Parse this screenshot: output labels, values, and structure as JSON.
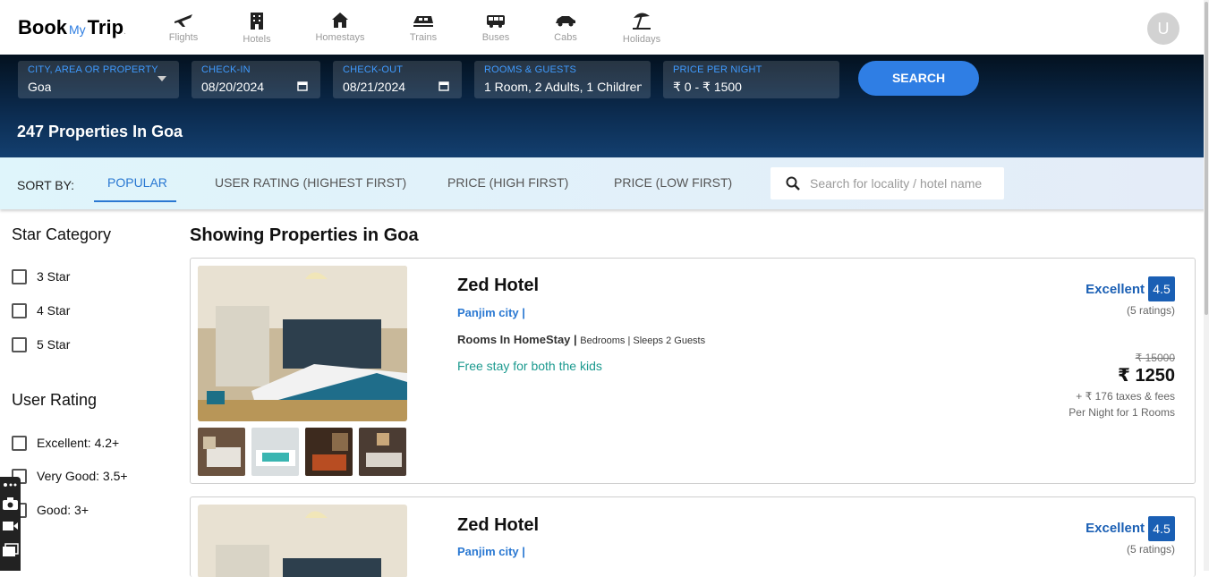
{
  "brand": {
    "part1": "Book",
    "part2": "My",
    "part3": "Trip",
    "dot": "."
  },
  "nav": [
    {
      "label": "Flights",
      "icon": "plane-icon"
    },
    {
      "label": "Hotels",
      "icon": "hotel-building-icon"
    },
    {
      "label": "Homestays",
      "icon": "house-icon"
    },
    {
      "label": "Trains",
      "icon": "train-icon"
    },
    {
      "label": "Buses",
      "icon": "bus-icon"
    },
    {
      "label": "Cabs",
      "icon": "car-icon"
    },
    {
      "label": "Holidays",
      "icon": "beach-umbrella-icon"
    }
  ],
  "user": {
    "initial": "U"
  },
  "search": {
    "city": {
      "label": "CITY, AREA OR PROPERTY",
      "value": "Goa"
    },
    "checkin": {
      "label": "CHECK-IN",
      "value": "08/20/2024"
    },
    "checkout": {
      "label": "CHECK-OUT",
      "value": "08/21/2024"
    },
    "guests": {
      "label": "ROOMS & GUESTS",
      "value": "1 Room, 2 Adults, 1 Children"
    },
    "price": {
      "label": "PRICE PER NIGHT",
      "value": "₹ 0 - ₹ 1500"
    },
    "button": "SEARCH",
    "results_count": "247 Properties In Goa"
  },
  "sort": {
    "label": "SORT BY:",
    "options": [
      "POPULAR",
      "USER RATING (HIGHEST FIRST)",
      "PRICE (HIGH FIRST)",
      "PRICE (LOW FIRST)"
    ],
    "active": "POPULAR",
    "search_placeholder": "Search for locality / hotel name"
  },
  "filters": {
    "star_title": "Star Category",
    "stars": [
      "3 Star",
      "4 Star",
      "5 Star"
    ],
    "rating_title": "User Rating",
    "ratings": [
      "Excellent: 4.2+",
      "Very Good: 3.5+",
      "Good: 3+"
    ]
  },
  "main": {
    "heading": "Showing Properties in Goa",
    "hotels": [
      {
        "name": "Zed Hotel",
        "city": "Panjim city |",
        "room_type": "Rooms In HomeStay |",
        "room_detail": "Bedrooms | Sleeps 2 Guests",
        "offer": "Free stay for both the kids",
        "rating_text": "Excellent",
        "rating": "4.5",
        "rating_count": "(5 ratings)",
        "original_price": "₹ 15000",
        "price": "₹ 1250",
        "taxes": "+ ₹ 176 taxes & fees",
        "per_night": "Per Night for 1 Rooms"
      },
      {
        "name": "Zed Hotel",
        "city": "Panjim city |",
        "rating_text": "Excellent",
        "rating": "4.5",
        "rating_count": "(5 ratings)"
      }
    ]
  },
  "colors": {
    "accent": "#2f7ee4",
    "rating": "#1a5fb4",
    "offer": "#1c9a8f",
    "band_top": "#03111f",
    "band_bottom": "#133f6f"
  }
}
